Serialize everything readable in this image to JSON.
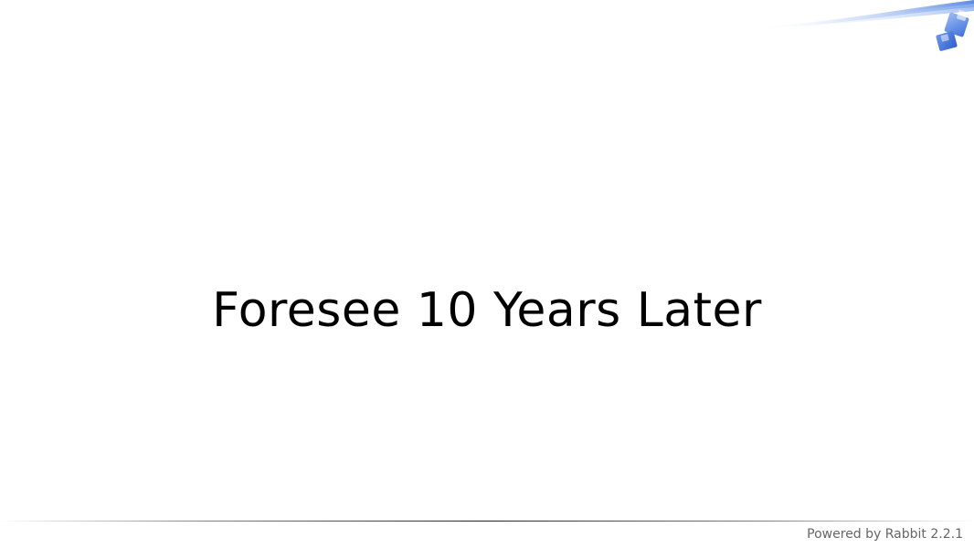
{
  "slide": {
    "title": "Foresee 10 Years Later",
    "footer_credit": "Powered by Rabbit 2.2.1"
  },
  "decoration": {
    "icon": "rabbit-corner-icon",
    "accent_color": "#4a7fe0",
    "rule_color": "#333333"
  }
}
